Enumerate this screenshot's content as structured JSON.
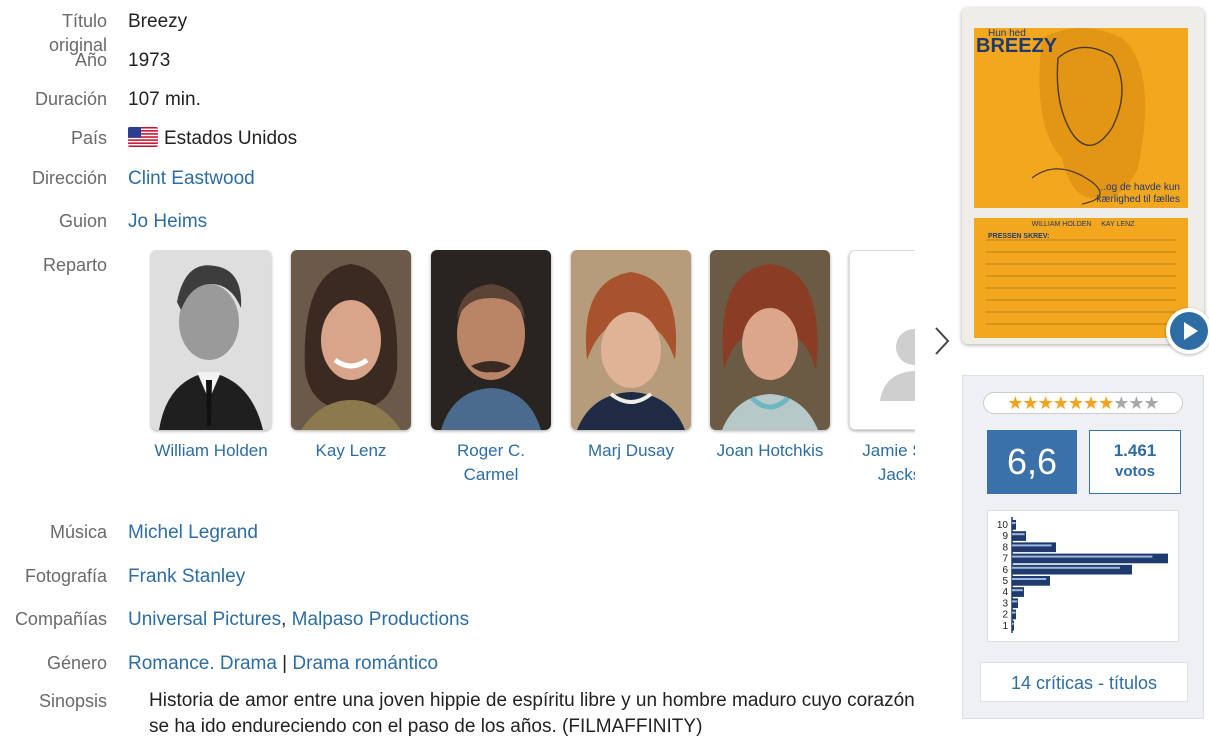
{
  "details": {
    "titulo_original": {
      "label": "Título original",
      "value": "Breezy"
    },
    "anio": {
      "label": "Año",
      "value": "1973"
    },
    "duracion": {
      "label": "Duración",
      "value": "107 min."
    },
    "pais": {
      "label": "País",
      "value": "Estados Unidos",
      "flag_icon": "us-flag-icon"
    },
    "direccion": {
      "label": "Dirección",
      "value": "Clint Eastwood"
    },
    "guion": {
      "label": "Guion",
      "value": "Jo Heims"
    },
    "reparto": {
      "label": "Reparto"
    },
    "musica": {
      "label": "Música",
      "value": "Michel Legrand"
    },
    "fotografia": {
      "label": "Fotografía",
      "value": "Frank Stanley"
    },
    "companias": {
      "label": "Compañías",
      "values": [
        "Universal Pictures",
        "Malpaso Productions"
      ],
      "separator": ", "
    },
    "genero": {
      "label": "Género",
      "values": [
        "Romance",
        "Drama",
        "Drama romántico"
      ],
      "sep1": ". ",
      "sep2": " | "
    },
    "sinopsis": {
      "label": "Sinopsis",
      "value": "Historia de amor entre una joven hippie de espíritu libre y un hombre maduro cuyo corazón se ha ido endureciendo con el paso de los años. (FILMAFFINITY)"
    }
  },
  "cast": [
    {
      "name": "William Holden",
      "photo_style": "bw"
    },
    {
      "name": "Kay Lenz",
      "photo_style": "color"
    },
    {
      "name": "Roger C. Carmel",
      "photo_style": "color"
    },
    {
      "name": "Marj Dusay",
      "photo_style": "color"
    },
    {
      "name": "Joan Hotchkis",
      "photo_style": "color"
    },
    {
      "name": "Jamie Smith Jackson",
      "photo_style": "placeholder"
    }
  ],
  "poster": {
    "title_small": "Hun hed",
    "title_big": "BREEZY",
    "tagline1": "...og de havde kun",
    "tagline2": "kærlighed til fælles",
    "actors": "WILLIAM HOLDEN     KAY LENZ",
    "press_heading": "PRESSEN SKREV:",
    "background_color": "#f5a623"
  },
  "rating": {
    "stars": "★★★★★★★★★★",
    "filled_stars": 7,
    "average": "6,6",
    "votes_count": "1.461",
    "votes_label": "votos",
    "histogram_scores": [
      "10",
      "9",
      "8",
      "7",
      "6",
      "5",
      "4",
      "3",
      "2",
      "1"
    ],
    "histogram_values": [
      2,
      7,
      22,
      78,
      60,
      19,
      6,
      3,
      2,
      1
    ],
    "critics_link": "14 críticas - títulos",
    "accent_color": "#3a71a8"
  }
}
